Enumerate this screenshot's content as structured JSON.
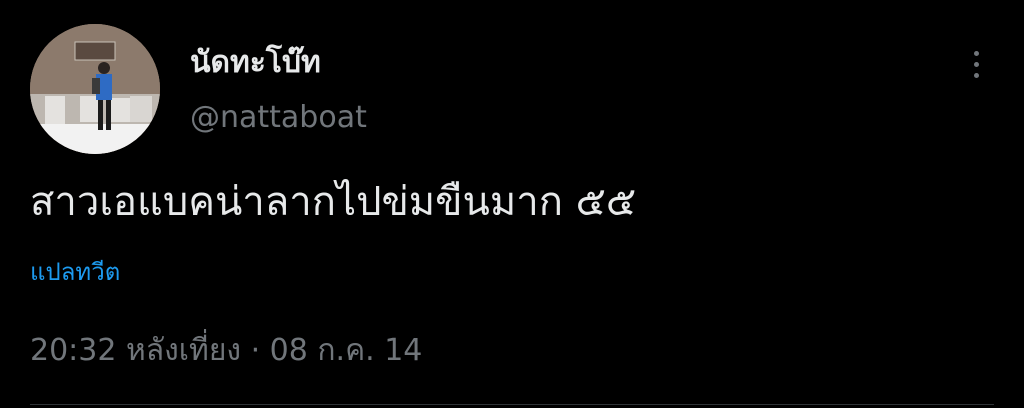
{
  "author": {
    "display_name": "นัดทะโบ๊ท",
    "handle": "@nattaboat",
    "avatar_icon": "profile-photo"
  },
  "tweet": {
    "text": "สาวเอแบคน่าลากไปข่มขืนมาก ๕๕",
    "translate_label": "แปลทวีต",
    "timestamp": "20:32 หลังเที่ยง · 08 ก.ค. 14"
  },
  "menu": {
    "more_icon": "more-vertical-icon"
  },
  "colors": {
    "background": "#000000",
    "primary_text": "#e7e9ea",
    "secondary_text": "#71767b",
    "link": "#1d9bf0"
  }
}
